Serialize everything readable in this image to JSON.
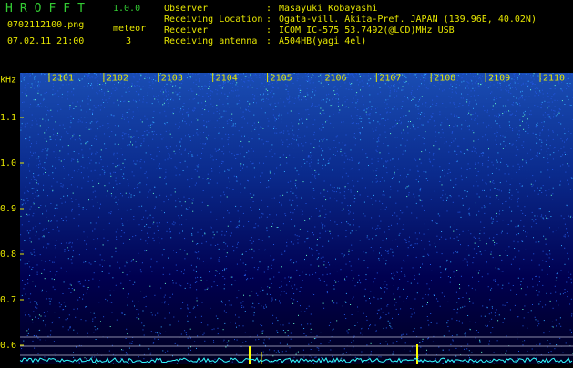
{
  "app": {
    "title": "HROFFT",
    "version": "1.0.0"
  },
  "file": {
    "name": "0702112100.png",
    "datetime": "07.02.11 21:00"
  },
  "meteor": {
    "label": "meteor",
    "count": "3"
  },
  "meta": [
    {
      "key": "Observer",
      "value": "Masayuki Kobayashi"
    },
    {
      "key": "Receiving Location",
      "value": "Ogata-vill. Akita-Pref. JAPAN (139.96E, 40.02N)"
    },
    {
      "key": "Receiver",
      "value": "ICOM IC-575 53.7492(@LCD)MHz USB"
    },
    {
      "key": "Receiving antenna",
      "value": "A504HB(yagi 4el)"
    }
  ],
  "axis": {
    "unit": "kHz",
    "freq_ticks": [
      "1.1",
      "1.0",
      "0.9",
      "0.8",
      "0.7",
      "0.6"
    ],
    "time_ticks": [
      "2101",
      "2102",
      "2103",
      "2104",
      "2105",
      "2106",
      "2107",
      "2108",
      "2109",
      "2110"
    ]
  },
  "colors": {
    "header_green": "#33cc33",
    "text_yellow": "#e6e600",
    "spectrum_dark": "#000050",
    "spectrum_mid": "#0a2a8c",
    "spectrum_hot": "#33ffcc",
    "meteor_trace": "#ffff00"
  }
}
